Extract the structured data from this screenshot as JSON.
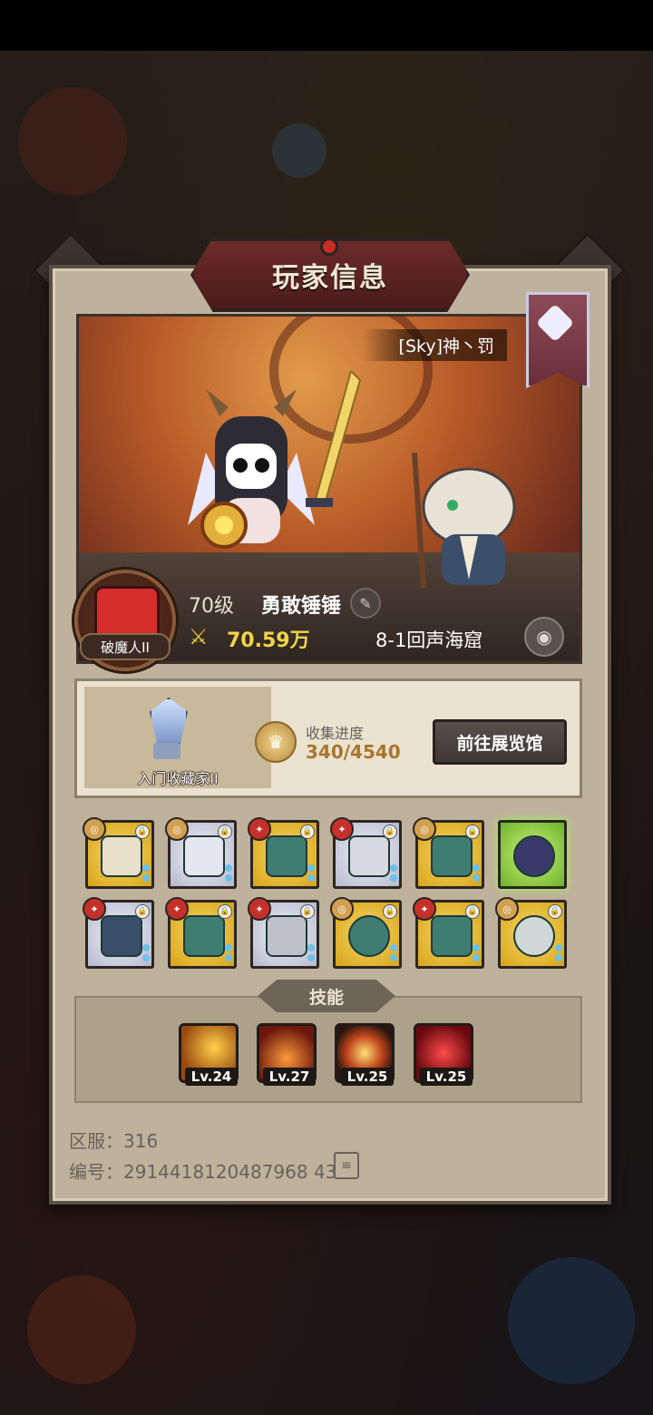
{
  "dialog": {
    "title": "玩家信息"
  },
  "player": {
    "name": "[Sky]神丶罚",
    "level": "70级",
    "nickname": "勇敢锤锤",
    "power": "70.59万",
    "stage": "8-1回声海窟",
    "avatar_title": "破魔人II"
  },
  "collection": {
    "badge_title": "入门收藏家II",
    "label": "收集进度",
    "value": "340/4540",
    "button_label": "前往展览馆"
  },
  "equipment": {
    "row1": [
      "gold",
      "silver",
      "gold",
      "silver",
      "gold",
      "green"
    ],
    "row2": [
      "silver",
      "gold",
      "silver",
      "gold",
      "gold",
      "gold"
    ]
  },
  "skills": {
    "header": "技能",
    "levels": [
      "Lv.24",
      "Lv.27",
      "Lv.25",
      "Lv.25"
    ]
  },
  "footer": {
    "server": "区服：316",
    "id": "编号：2914418120487968 43"
  }
}
